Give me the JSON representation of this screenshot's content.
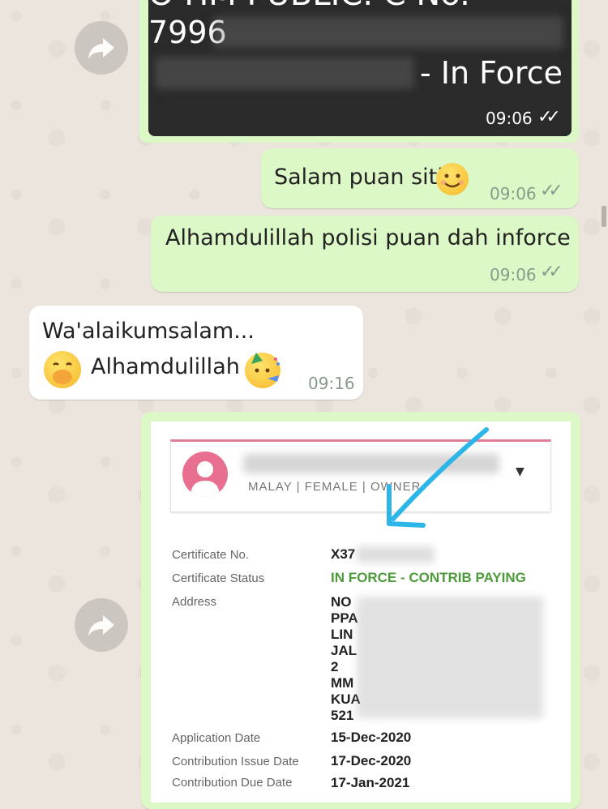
{
  "top_image": {
    "line1": "O HM PUBLIC. C No.",
    "line2_prefix": "7996",
    "line3_suffix": "- In Force",
    "time": "09:06"
  },
  "messages": [
    {
      "text": "Salam puan siti",
      "time": "09:06",
      "dir": "out"
    },
    {
      "text": "Alhamdulillah polisi puan dah inforce",
      "time": "09:06",
      "dir": "out"
    },
    {
      "text_line1": "Wa'alaikumsalam...",
      "text_line2": "Alhamdulillah",
      "time": "09:16",
      "dir": "in"
    }
  ],
  "policy": {
    "profile_meta": "MALAY | FEMALE | OWNER",
    "rows": [
      {
        "label": "Certificate No.",
        "value": "X37"
      },
      {
        "label": "Certificate Status",
        "value": "IN FORCE - CONTRIB PAYING"
      },
      {
        "label": "Address",
        "value_lines": [
          "NO",
          "PPA",
          "LIN",
          "JAL",
          "2",
          "MM",
          "KUA",
          "521"
        ]
      },
      {
        "label": "Application Date",
        "value": "15-Dec-2020"
      },
      {
        "label": "Contribution Issue Date",
        "value": "17-Dec-2020"
      },
      {
        "label": "Contribution Due Date",
        "value": "17-Jan-2021"
      }
    ]
  },
  "colors": {
    "wallpaper": "#ece5dd",
    "outgoing_bubble": "#dcf8c6",
    "incoming_bubble": "#ffffff",
    "status_green": "#4d9a3a",
    "avatar_pink": "#e86f8f",
    "arrow_blue": "#2bb5e8"
  }
}
